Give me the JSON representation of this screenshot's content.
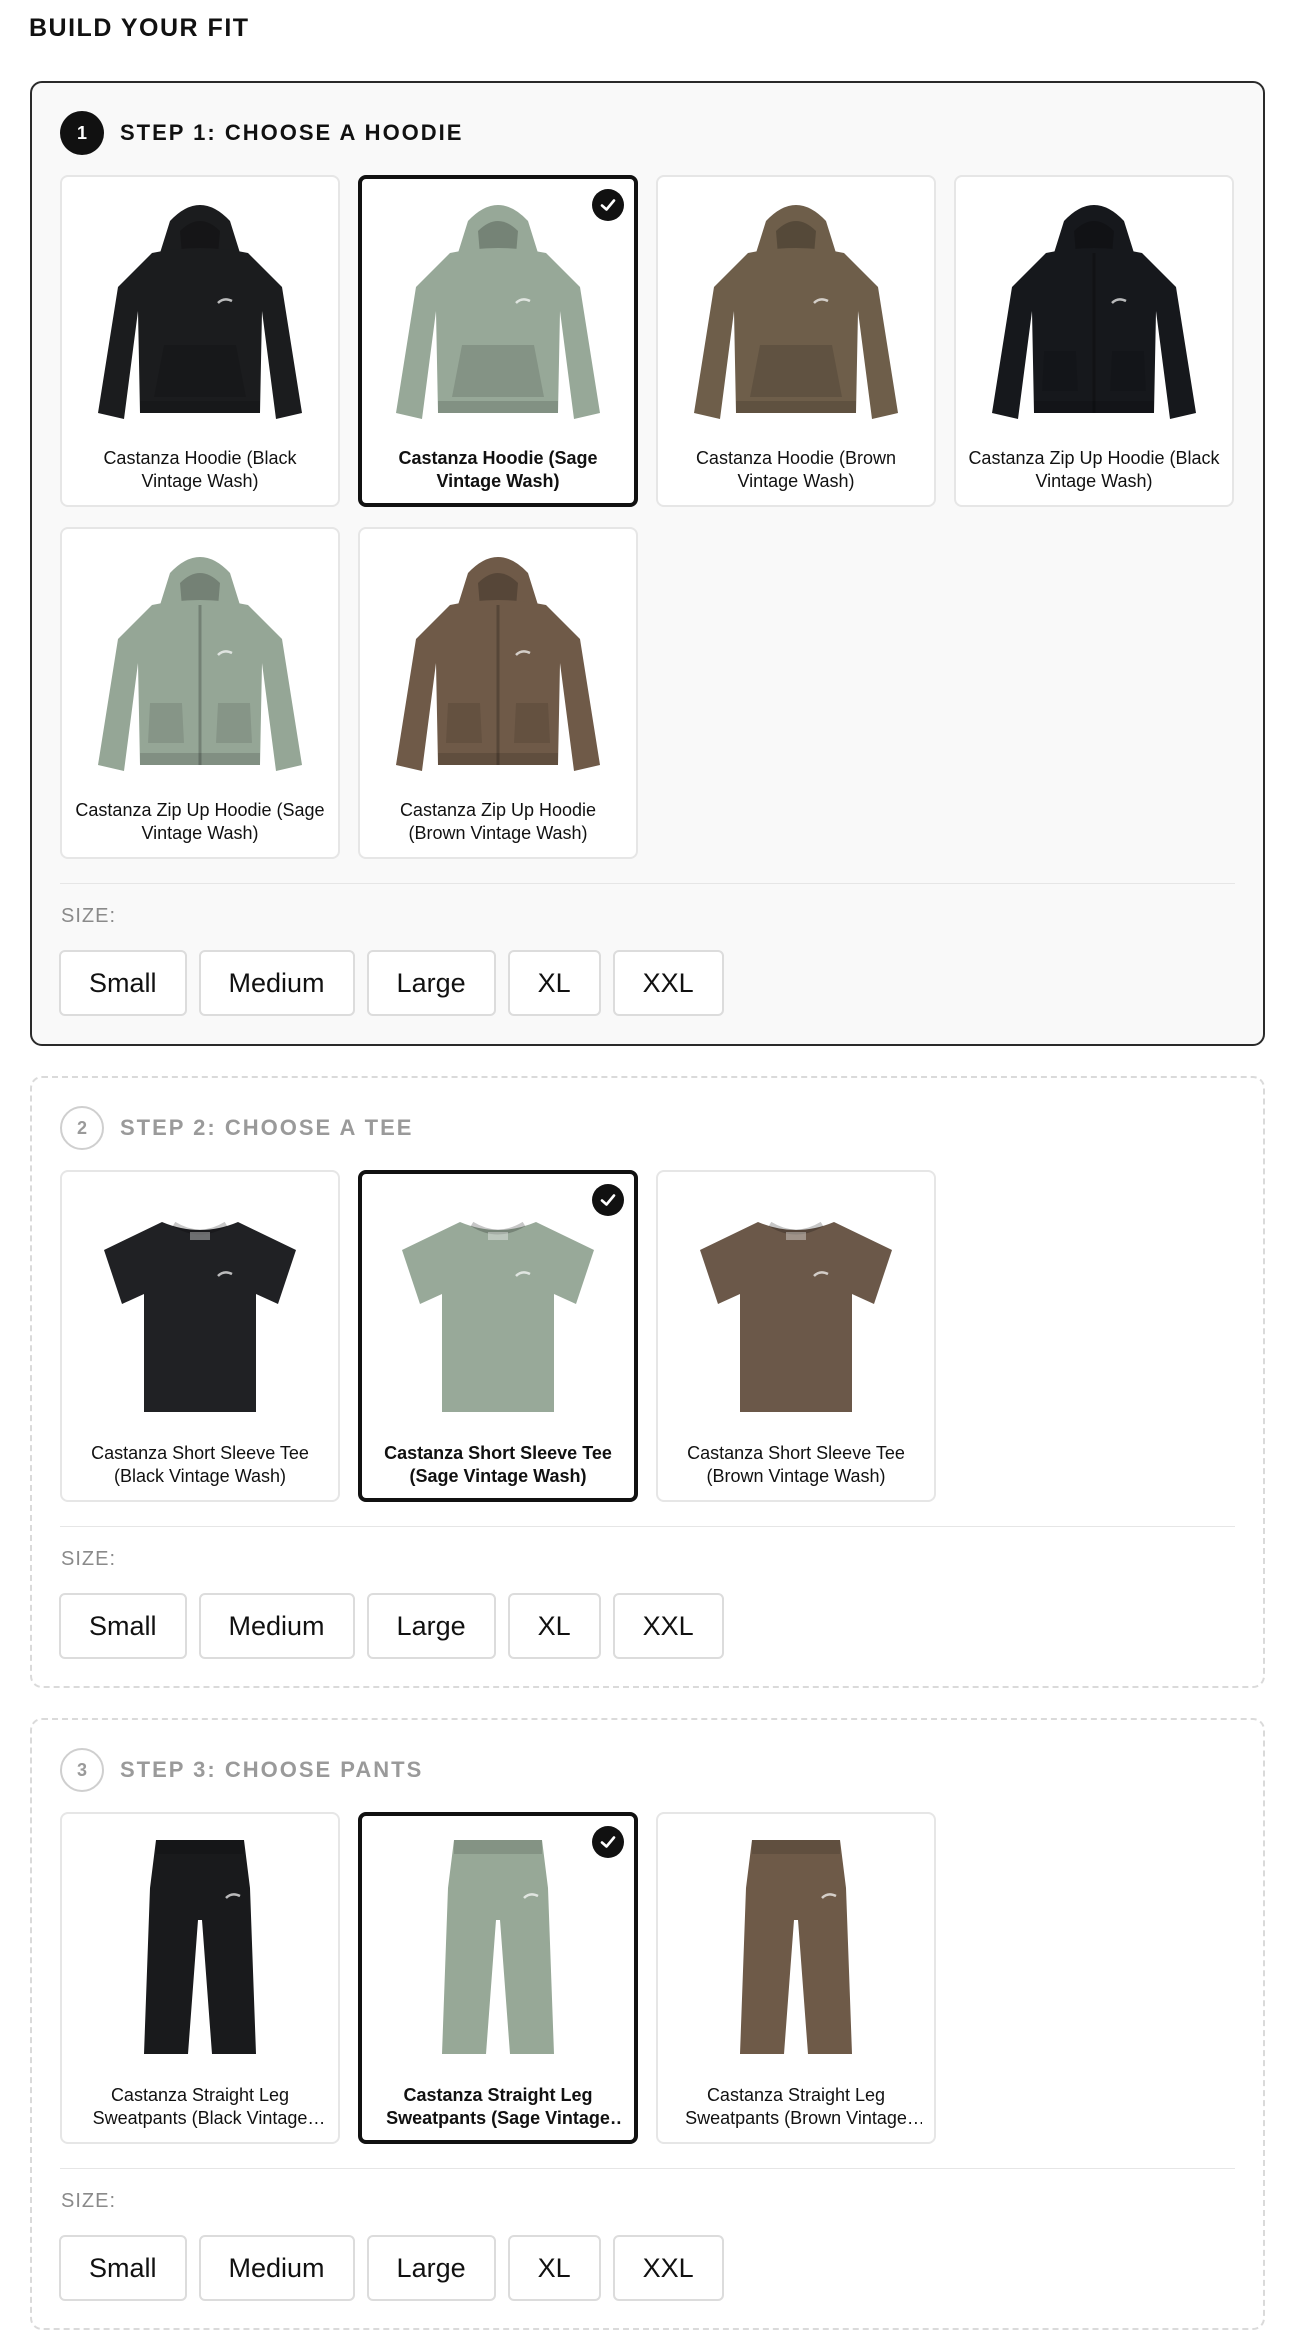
{
  "page": {
    "title": "BUILD YOUR FIT"
  },
  "steps": [
    {
      "number": "1",
      "title": "STEP 1: CHOOSE A HOODIE",
      "active": true,
      "size_label": "SIZE:",
      "sizes": [
        "Small",
        "Medium",
        "Large",
        "XL",
        "XXL"
      ],
      "products": [
        {
          "name": "Castanza Hoodie (Black Vintage Wash)",
          "kind": "hoodie",
          "color": "#1b1c1e",
          "selected": false
        },
        {
          "name": "Castanza Hoodie (Sage Vintage Wash)",
          "kind": "hoodie",
          "color": "#97a898",
          "selected": true
        },
        {
          "name": "Castanza Hoodie (Brown Vintage Wash)",
          "kind": "hoodie",
          "color": "#6e5e4a",
          "selected": false
        },
        {
          "name": "Castanza Zip Up Hoodie (Black Vintage Wash)",
          "kind": "zip-hoodie",
          "color": "#16181c",
          "selected": false
        },
        {
          "name": "Castanza Zip Up Hoodie (Sage Vintage Wash)",
          "kind": "zip-hoodie",
          "color": "#95a696",
          "selected": false
        },
        {
          "name": "Castanza Zip Up Hoodie (Brown Vintage Wash)",
          "kind": "zip-hoodie",
          "color": "#6f5a48",
          "selected": false
        }
      ]
    },
    {
      "number": "2",
      "title": "STEP 2: CHOOSE A TEE",
      "active": false,
      "size_label": "SIZE:",
      "sizes": [
        "Small",
        "Medium",
        "Large",
        "XL",
        "XXL"
      ],
      "products": [
        {
          "name": "Castanza Short Sleeve Tee (Black Vintage Wash)",
          "kind": "tee",
          "color": "#202124",
          "selected": false
        },
        {
          "name": "Castanza Short Sleeve Tee (Sage Vintage Wash)",
          "kind": "tee",
          "color": "#98a999",
          "selected": true
        },
        {
          "name": "Castanza Short Sleeve Tee (Brown Vintage Wash)",
          "kind": "tee",
          "color": "#6b5849",
          "selected": false
        }
      ]
    },
    {
      "number": "3",
      "title": "STEP 3: CHOOSE PANTS",
      "active": false,
      "size_label": "SIZE:",
      "sizes": [
        "Small",
        "Medium",
        "Large",
        "XL",
        "XXL"
      ],
      "products": [
        {
          "name": "Castanza Straight Leg Sweatpants (Black Vintage Wash)",
          "kind": "pants",
          "color": "#191a1c",
          "selected": false
        },
        {
          "name": "Castanza Straight Leg Sweatpants (Sage Vintage Wash)",
          "kind": "pants",
          "color": "#97a897",
          "selected": true
        },
        {
          "name": "Castanza Straight Leg Sweatpants (Brown Vintage Wash)",
          "kind": "pants",
          "color": "#6e5a48",
          "selected": false
        }
      ]
    }
  ]
}
